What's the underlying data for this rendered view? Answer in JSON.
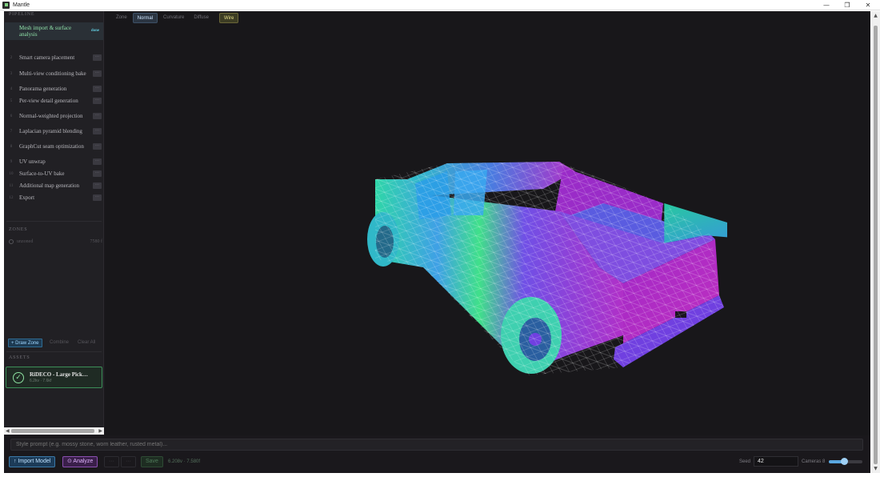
{
  "window": {
    "title": "Mantle",
    "controls": [
      "—",
      "❐",
      "✕"
    ]
  },
  "sidebar": {
    "pipeline_heading": "PIPELINE",
    "steps": [
      {
        "num": "",
        "label": "Mesh import & surface analysis",
        "badge": "done",
        "active": true
      },
      {
        "num": "2",
        "label": "Smart camera placement",
        "badge": "···"
      },
      {
        "num": "3",
        "label": "Multi-view conditioning bake",
        "badge": "···"
      },
      {
        "num": "4",
        "label": "Panorama generation",
        "badge": "···"
      },
      {
        "num": "5",
        "label": "Per-view detail generation",
        "badge": "···"
      },
      {
        "num": "6",
        "label": "Normal-weighted projection",
        "badge": "···"
      },
      {
        "num": "7",
        "label": "Laplacian pyramid blending",
        "badge": "···"
      },
      {
        "num": "8",
        "label": "GraphCut seam optimization",
        "badge": "···"
      },
      {
        "num": "9",
        "label": "UV unwrap",
        "badge": "···"
      },
      {
        "num": "10",
        "label": "Surface-to-UV bake",
        "badge": "···"
      },
      {
        "num": "11",
        "label": "Additional map generation",
        "badge": "···"
      },
      {
        "num": "12",
        "label": "Export",
        "badge": "···"
      }
    ],
    "zones_heading": "ZONES",
    "zone": {
      "label": "unzoned",
      "count": "7580 f"
    },
    "zone_buttons": {
      "draw": "+ Draw Zone",
      "combine": "Combine",
      "clear": "Clear All"
    },
    "assets_heading": "ASSETS",
    "asset": {
      "name": "RiDECO - Large Pick…",
      "meta": "6.2kv · 7.6kf"
    }
  },
  "viewport": {
    "tabs": [
      {
        "label": "Zone",
        "state": "off"
      },
      {
        "label": "Normal",
        "state": "on"
      },
      {
        "label": "Curvature",
        "state": "off"
      },
      {
        "label": "Diffuse",
        "state": "off"
      },
      {
        "label": "Wire",
        "state": "wire"
      }
    ]
  },
  "bottom": {
    "prompt_placeholder": "Style prompt (e.g. mossy stone, worn leather, rusted metal)...",
    "import_label": "↑ Import Model",
    "analyze_label": "⊙ Analyze",
    "ghost1": "···",
    "ghost2": "···",
    "save_label": "Save",
    "stats": "6.208v · 7.580f",
    "seed_label": "Seed",
    "seed_value": "42",
    "cameras_label": "Cameras 8",
    "cameras_level": 0.45
  },
  "colors": {
    "accent_blue": "#3a78a8",
    "accent_purple": "#8a4fb0",
    "accent_green": "#3c8f58",
    "wire": "#e7df8a"
  }
}
